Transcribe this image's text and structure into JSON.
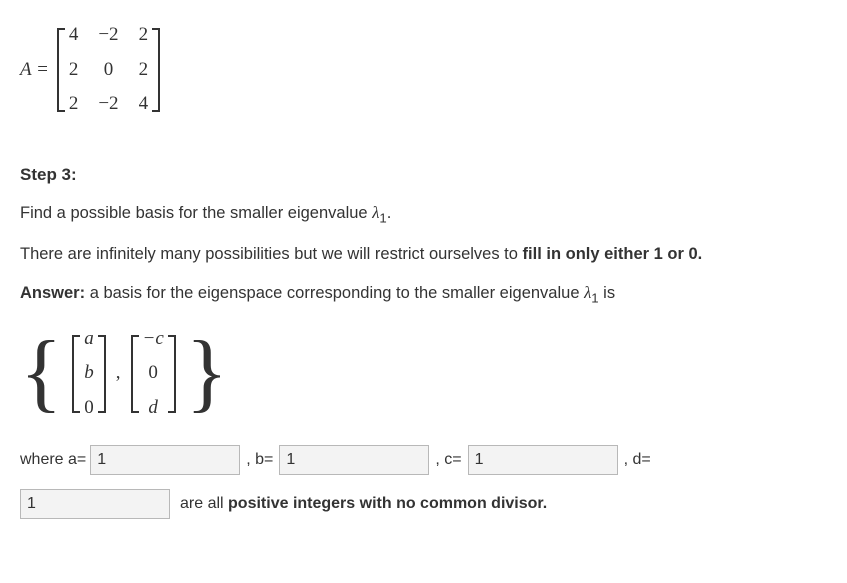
{
  "matrix": {
    "lhs": "A =",
    "rows": [
      [
        "4",
        "−2",
        "2"
      ],
      [
        "2",
        "0",
        "2"
      ],
      [
        "2",
        "−2",
        "4"
      ]
    ]
  },
  "step": {
    "title": "Step 3:",
    "line1_pre": "Find a possible basis for the smaller eigenvalue ",
    "lambda1": "λ",
    "lambda1_sub": "1",
    "line1_post": ".",
    "line2_pre": "There are infinitely many possibilities but we will restrict ourselves to ",
    "line2_bold": "fill in only either 1 or 0.",
    "answer_label": "Answer:",
    "answer_text": " a basis for the eigenspace corresponding to the smaller eigenvalue ",
    "answer_post": " is"
  },
  "basis": {
    "v1": [
      "a",
      "b",
      "0"
    ],
    "v2": [
      "−c",
      "0",
      "d"
    ],
    "comma": ","
  },
  "inputs": {
    "where": "where a=",
    "a": "1",
    "b_label": ", b=",
    "b": "1",
    "c_label": ", c=",
    "c": "1",
    "d_label": ", d=",
    "d": "1",
    "tail": "are all ",
    "tail_bold": "positive integers with no common divisor."
  }
}
